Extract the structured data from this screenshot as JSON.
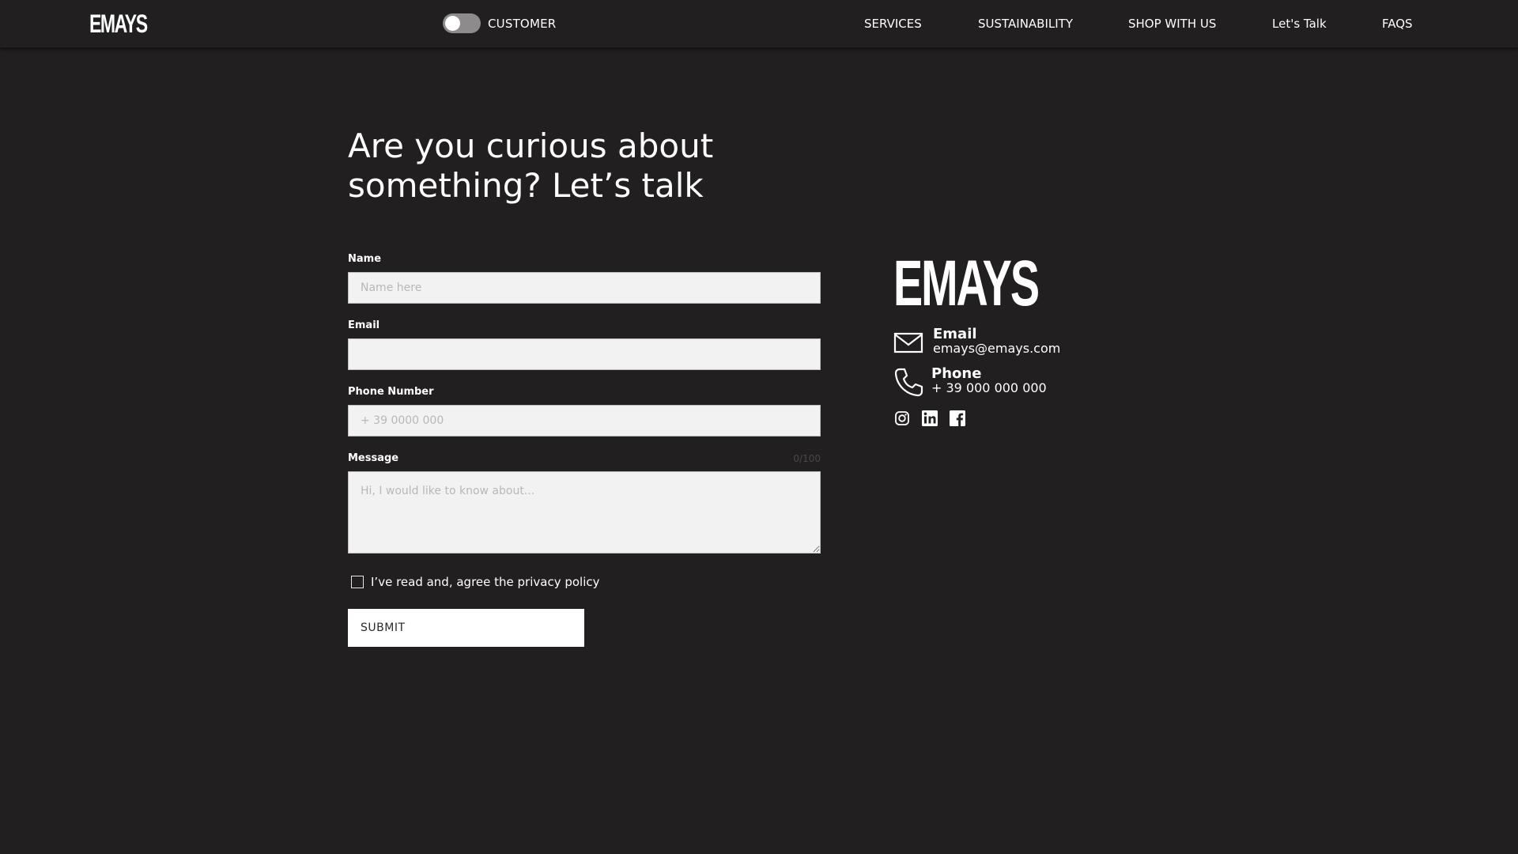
{
  "header": {
    "logo": "EMAYS",
    "toggle_label": "CUSTOMER",
    "nav": [
      "SERVICES",
      "SUSTAINABILITY",
      "SHOP WITH US",
      "Let's Talk",
      "FAQS"
    ]
  },
  "main": {
    "heading_line1": "Are you curious about",
    "heading_line2": "something? Let’s talk"
  },
  "form": {
    "name_label": "Name",
    "name_placeholder": "Name here",
    "email_label": "Email",
    "email_placeholder": "",
    "phone_label": "Phone Number",
    "phone_placeholder": "+ 39 0000 000",
    "message_label": "Message",
    "message_placeholder": "Hi, I would like to know about...",
    "char_count": "0/100",
    "privacy_label": "I’ve read and, agree the privacy policy",
    "submit_label": "SUBMIT"
  },
  "contact": {
    "logo": "EMAYS",
    "email_title": "Email",
    "email_value": "emays@emays.com",
    "phone_title": "Phone",
    "phone_value": "+ 39 000 000 000"
  },
  "colors": {
    "background": "#211f20",
    "input_bg": "#f2f2f2",
    "toggle_track": "#8d8b8c",
    "text": "#ffffff"
  }
}
